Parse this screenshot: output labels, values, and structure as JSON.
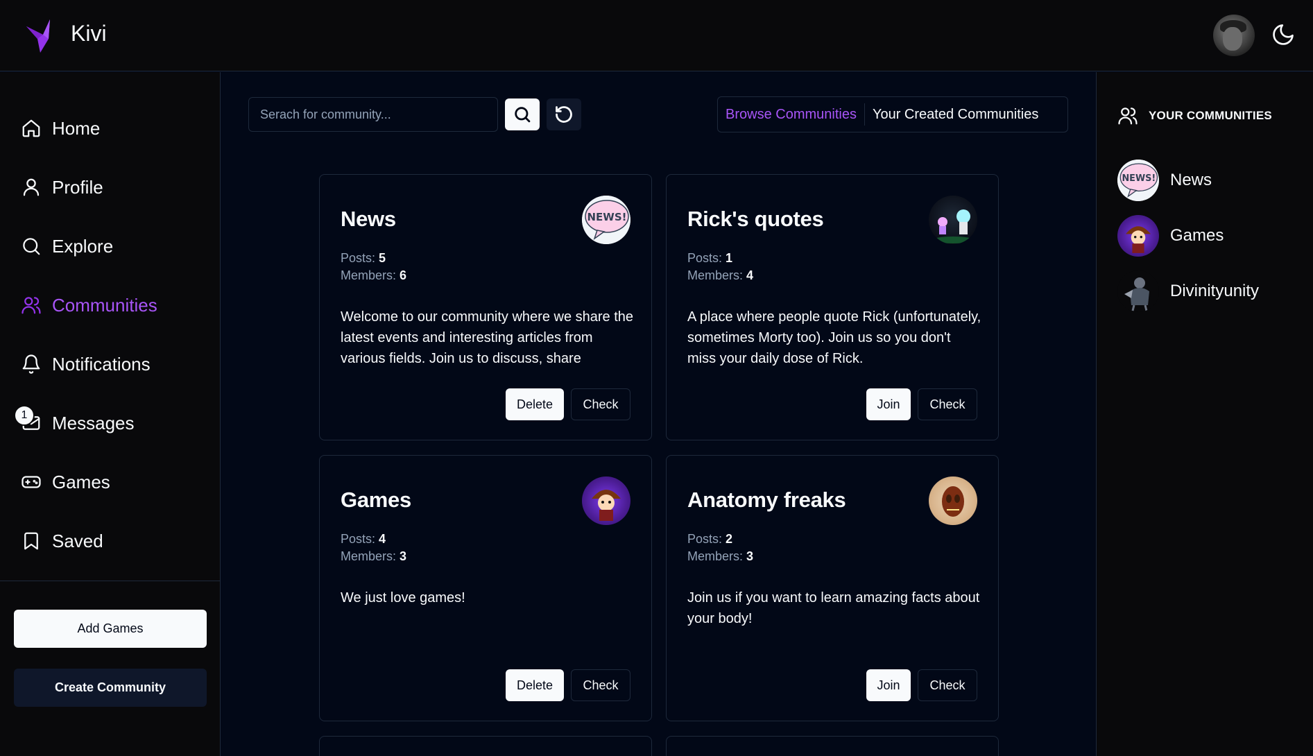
{
  "app": {
    "brand": "Kivi",
    "brand_color": "#9333ea"
  },
  "header": {
    "avatar_icon": "user-avatar",
    "theme_icon": "moon-icon"
  },
  "nav": {
    "items": [
      {
        "label": "Home",
        "icon": "home-icon"
      },
      {
        "label": "Profile",
        "icon": "user-icon"
      },
      {
        "label": "Explore",
        "icon": "search-icon"
      },
      {
        "label": "Communities",
        "icon": "users-icon",
        "active": true
      },
      {
        "label": "Notifications",
        "icon": "bell-icon"
      },
      {
        "label": "Messages",
        "icon": "mail-icon",
        "badge": "1"
      },
      {
        "label": "Games",
        "icon": "gamepad-icon"
      },
      {
        "label": "Saved",
        "icon": "bookmark-icon"
      }
    ],
    "add_games": "Add Games",
    "create_community": "Create Community"
  },
  "toolbar": {
    "search_placeholder": "Serach for community...",
    "search_value": "",
    "tabs": [
      "Browse Communities",
      "Your Created Communities"
    ],
    "active_tab": "Browse Communities"
  },
  "cards": [
    {
      "title": "News",
      "posts_label": "Posts:",
      "posts": "5",
      "members_label": "Members:",
      "members": "6",
      "description": "Welcome to our community where we share the latest events and interesting articles from various fields. Join us to discuss, share",
      "primary": "Delete",
      "secondary": "Check",
      "avatar": "news-avatar"
    },
    {
      "title": "Rick's quotes",
      "posts_label": "Posts:",
      "posts": "1",
      "members_label": "Members:",
      "members": "4",
      "description": "A place where people quote Rick (unfortunately, sometimes Morty too). Join us so you don't miss your daily dose of Rick.",
      "primary": "Join",
      "secondary": "Check",
      "avatar": "rick-avatar"
    },
    {
      "title": "Games",
      "posts_label": "Posts:",
      "posts": "4",
      "members_label": "Members:",
      "members": "3",
      "description": "We just love games!",
      "primary": "Delete",
      "secondary": "Check",
      "avatar": "games-avatar"
    },
    {
      "title": "Anatomy freaks",
      "posts_label": "Posts:",
      "posts": "2",
      "members_label": "Members:",
      "members": "3",
      "description": "Join us if you want to learn amazing facts about your body!",
      "primary": "Join",
      "secondary": "Check",
      "avatar": "anatomy-avatar"
    }
  ],
  "your_communities": {
    "heading": "YOUR COMMUNITIES",
    "items": [
      {
        "label": "News",
        "avatar": "news-avatar"
      },
      {
        "label": "Games",
        "avatar": "games-avatar"
      },
      {
        "label": "Divinityunity",
        "avatar": "divinityunity-avatar"
      }
    ]
  }
}
